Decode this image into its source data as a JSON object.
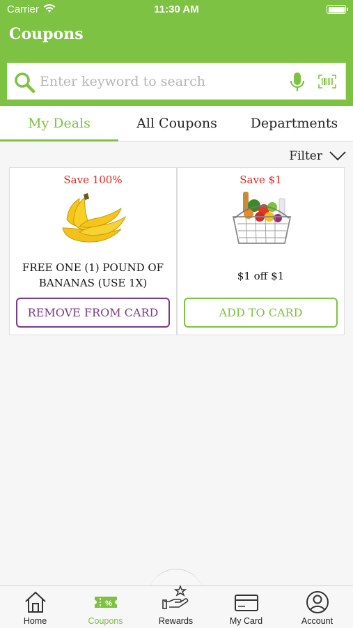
{
  "status_bar": {
    "carrier": "Carrier",
    "time": "11:30 AM"
  },
  "header": {
    "title": "Coupons"
  },
  "search": {
    "placeholder": "Enter keyword to search"
  },
  "tabs": [
    {
      "label": "My Deals",
      "active": true
    },
    {
      "label": "All Coupons",
      "active": false
    },
    {
      "label": "Departments",
      "active": false
    }
  ],
  "filter": {
    "label": "Filter"
  },
  "coupons": [
    {
      "save": "Save 100%",
      "description": "FREE ONE (1) POUND OF BANANAS (USE 1X)",
      "button": "REMOVE FROM CARD",
      "image": "bananas-image"
    },
    {
      "save": "Save $1",
      "description": "$1 off $1",
      "button": "ADD TO CARD",
      "image": "grocery-basket-image"
    }
  ],
  "bottom_nav": [
    {
      "label": "Home",
      "icon": "home-icon"
    },
    {
      "label": "Coupons",
      "icon": "coupon-icon",
      "active": true
    },
    {
      "label": "Rewards",
      "icon": "rewards-icon"
    },
    {
      "label": "My Card",
      "icon": "card-icon"
    },
    {
      "label": "Account",
      "icon": "account-icon"
    }
  ],
  "colors": {
    "brand_green": "#7dc242",
    "save_red": "#e8241c",
    "remove_purple": "#7a3a87"
  }
}
